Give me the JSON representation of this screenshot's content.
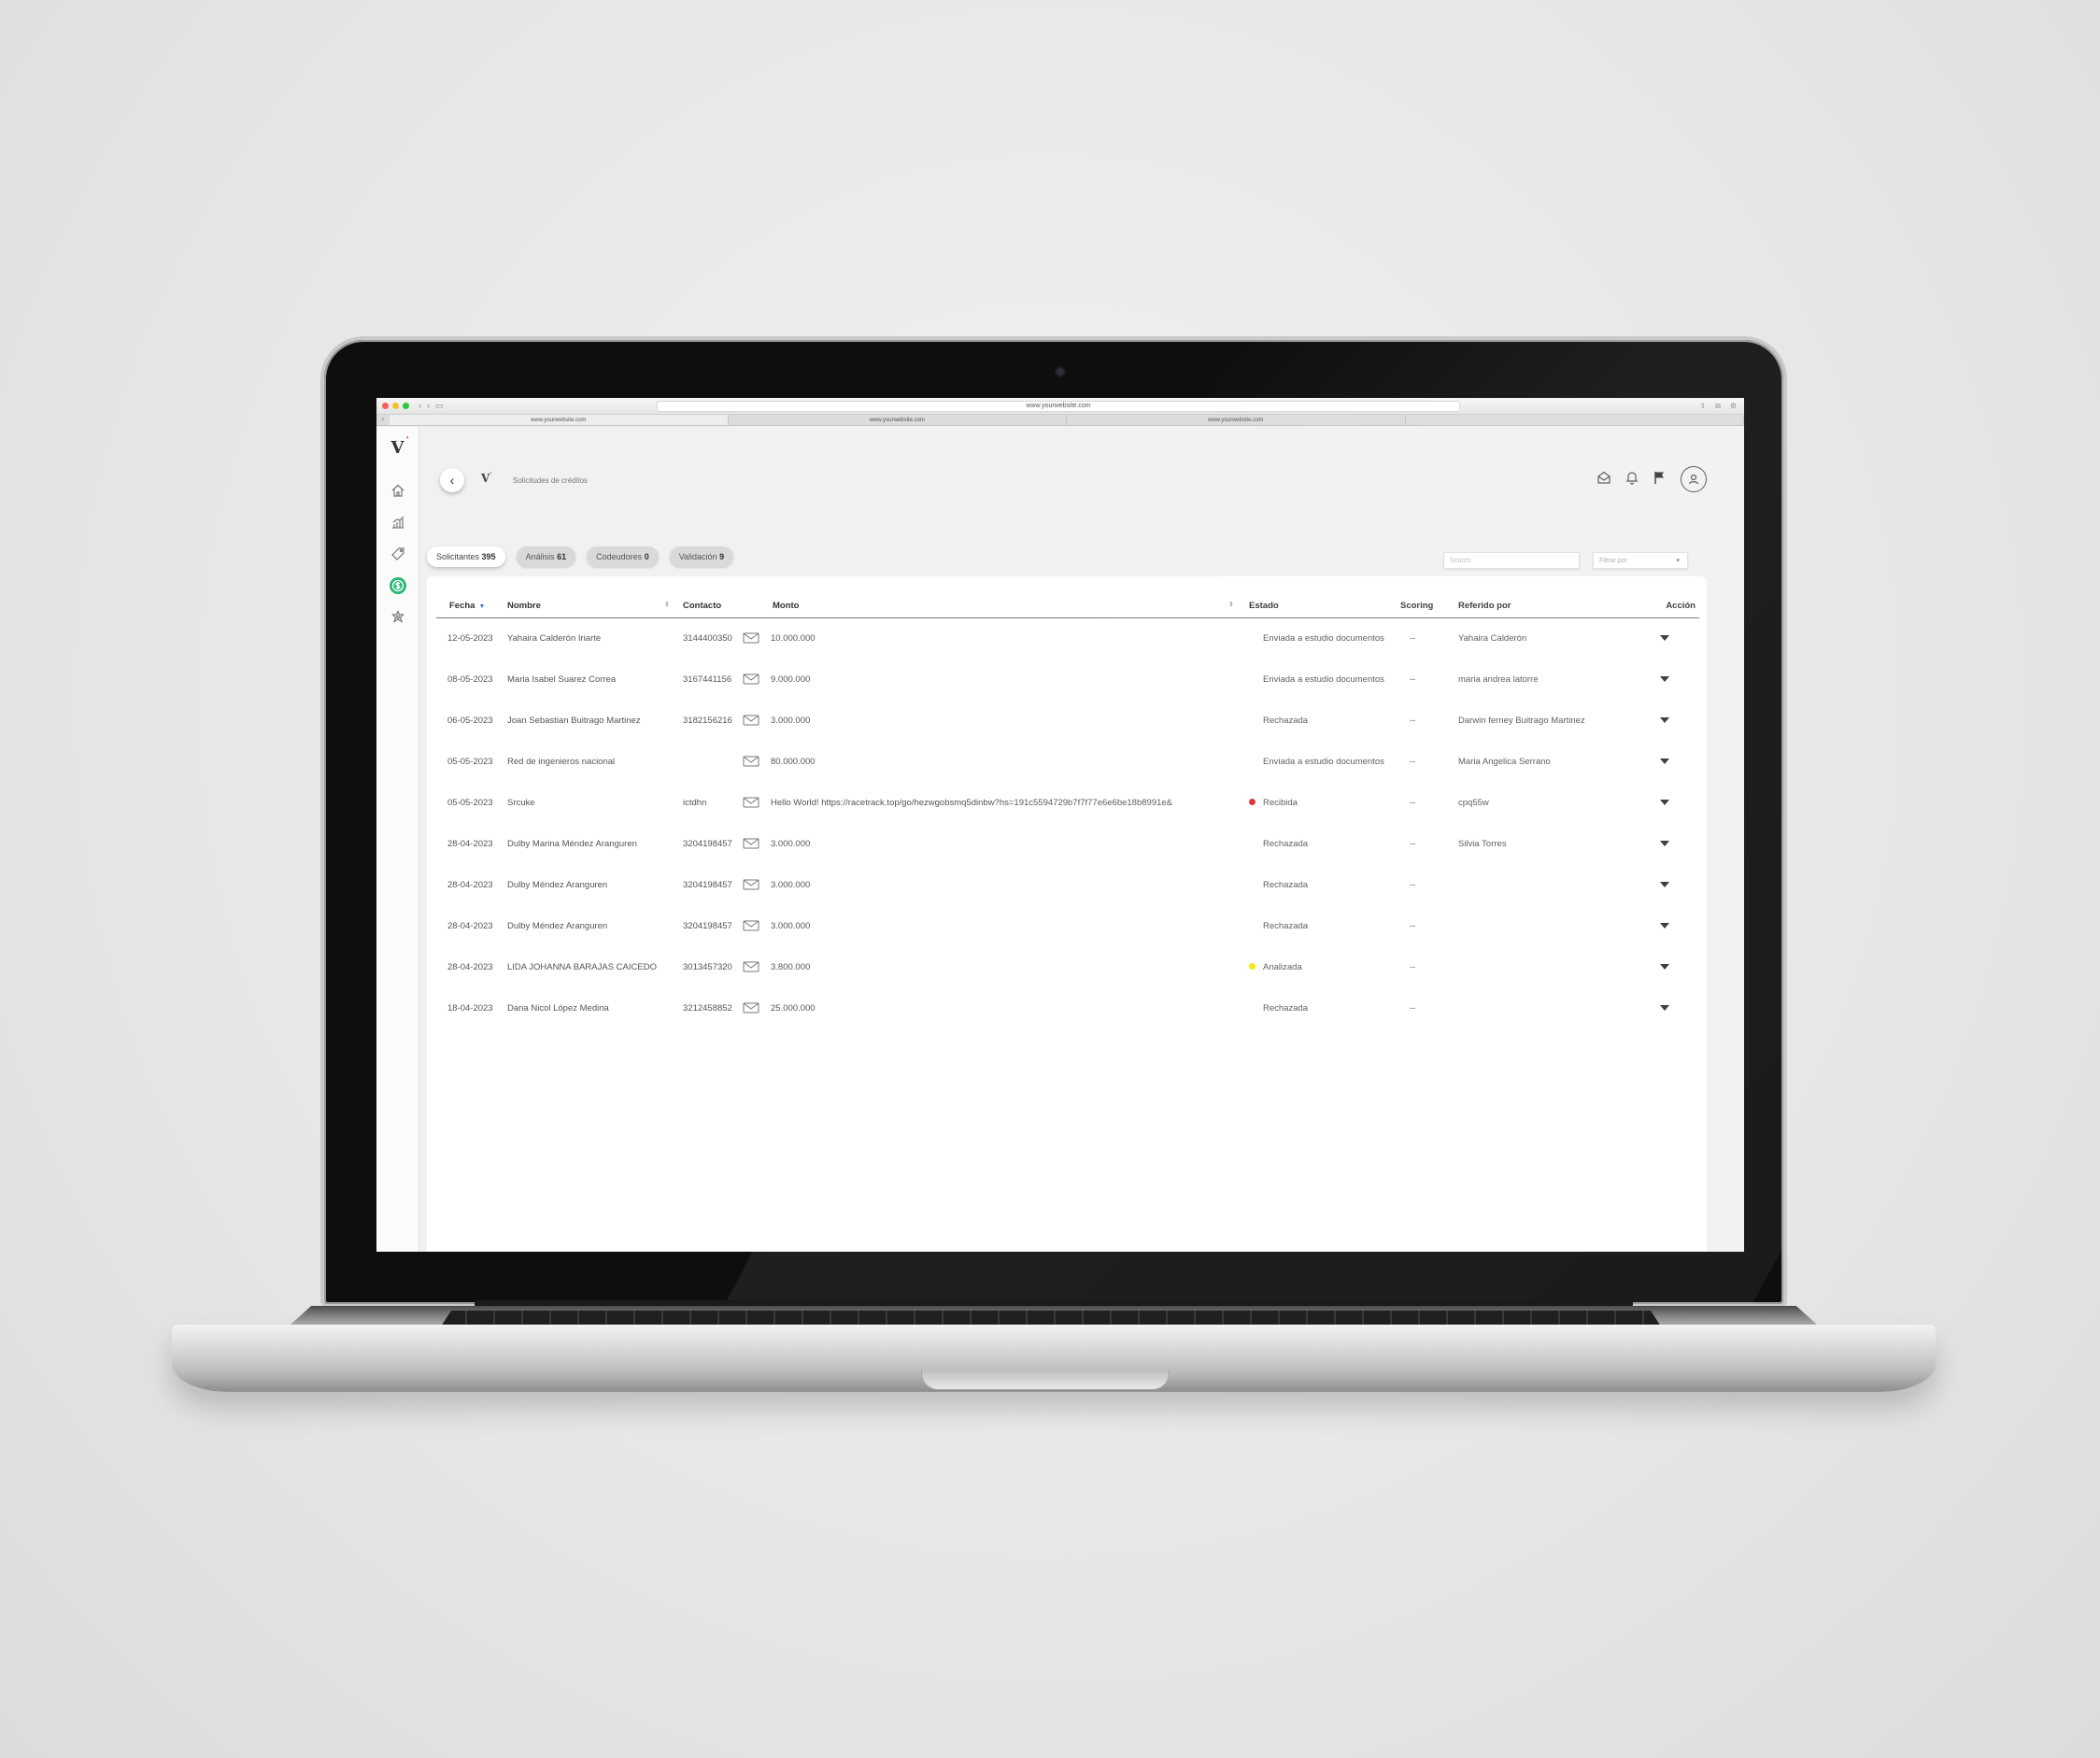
{
  "browser": {
    "url": "www.yourwebsite.com",
    "tabs": [
      "www.yourwebsite.com",
      "www.yourwebsite.com",
      "www.yourwebsite.com"
    ]
  },
  "app": {
    "logo_letter": "V",
    "logo_mark": "'",
    "breadcrumb": "Solicitudes de créditos"
  },
  "pills": [
    {
      "label": "Solicitantes",
      "count": "395"
    },
    {
      "label": "Análisis",
      "count": "61"
    },
    {
      "label": "Codeudores",
      "count": "0"
    },
    {
      "label": "Validación",
      "count": "9"
    }
  ],
  "search": {
    "placeholder": "Search"
  },
  "filter": {
    "label": "Filtrar por"
  },
  "table": {
    "headers": {
      "fecha": "Fecha",
      "nombre": "Nombre",
      "contacto": "Contacto",
      "monto": "Monto",
      "estado": "Estado",
      "scoring": "Scoring",
      "referido": "Referido por",
      "accion": "Acción"
    },
    "rows": [
      {
        "fecha": "12-05-2023",
        "nombre": "Yahaira Calderón Iriarte",
        "contacto": "3144400350",
        "monto": "10.000.000",
        "estado": "Enviada a estudio documentos",
        "estado_color": "",
        "scoring": "--",
        "referido": "Yahaira Calderón"
      },
      {
        "fecha": "08-05-2023",
        "nombre": "Maria Isabel Suarez Correa",
        "contacto": "3167441156",
        "monto": "9.000.000",
        "estado": "Enviada a estudio documentos",
        "estado_color": "",
        "scoring": "--",
        "referido": "maria andrea latorre"
      },
      {
        "fecha": "06-05-2023",
        "nombre": "Joan Sebastian Buitrago Martinez",
        "contacto": "3182156216",
        "monto": "3.000.000",
        "estado": "Rechazada",
        "estado_color": "",
        "scoring": "--",
        "referido": "Darwin ferney Buitrago Martinez"
      },
      {
        "fecha": "05-05-2023",
        "nombre": "Red de ingenieros nacional",
        "contacto": "",
        "monto": "80.000.000",
        "estado": "Enviada a estudio documentos",
        "estado_color": "",
        "scoring": "--",
        "referido": "Maria Angelica Serrano"
      },
      {
        "fecha": "05-05-2023",
        "nombre": "Srcuke",
        "contacto": "ictdhn",
        "monto": "Hello World! https://racetrack.top/go/hezwgobsmq5dinbw?hs=191c5594729b7f7f77e6e6be18b8991e&",
        "estado": "Recibida",
        "estado_color": "#e0262b",
        "scoring": "--",
        "referido": "cpq55w"
      },
      {
        "fecha": "28-04-2023",
        "nombre": "Dulby Marina Méndez Aranguren",
        "contacto": "3204198457",
        "monto": "3.000.000",
        "estado": "Rechazada",
        "estado_color": "",
        "scoring": "--",
        "referido": "Silvia Torres"
      },
      {
        "fecha": "28-04-2023",
        "nombre": "Dulby Méndez Aranguren",
        "contacto": "3204198457",
        "monto": "3.000.000",
        "estado": "Rechazada",
        "estado_color": "",
        "scoring": "--",
        "referido": ""
      },
      {
        "fecha": "28-04-2023",
        "nombre": "Dulby Méndez Aranguren",
        "contacto": "3204198457",
        "monto": "3.000.000",
        "estado": "Rechazada",
        "estado_color": "",
        "scoring": "--",
        "referido": ""
      },
      {
        "fecha": "28-04-2023",
        "nombre": "LIDA JOHANNA BARAJAS CAICEDO",
        "contacto": "3013457320",
        "monto": "3.800.000",
        "estado": "Analizada",
        "estado_color": "#f2e600",
        "scoring": "--",
        "referido": ""
      },
      {
        "fecha": "18-04-2023",
        "nombre": "Dana Nicol López Medina",
        "contacto": "3212458852",
        "monto": "25.000.000",
        "estado": "Rechazada",
        "estado_color": "",
        "scoring": "--",
        "referido": ""
      }
    ]
  },
  "colors": {
    "accent_green": "#2bb673",
    "logo_red": "#d2232a",
    "sort_blue": "#4a6fd1"
  },
  "icons": {
    "sidebar": [
      "home-icon",
      "chart-icon",
      "tag-icon",
      "dollar-icon",
      "settings-icon"
    ],
    "top": [
      "mail-open-icon",
      "bell-icon",
      "flag-icon",
      "user-icon"
    ]
  }
}
